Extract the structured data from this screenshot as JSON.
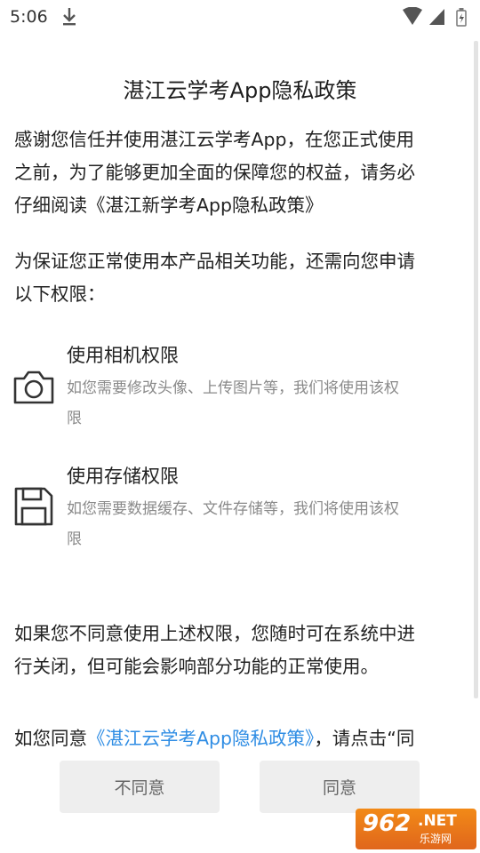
{
  "status_bar": {
    "time": "5:06",
    "icons": [
      "download-icon",
      "wifi-icon",
      "signal-icon",
      "battery-icon"
    ]
  },
  "dialog": {
    "title": "湛江云学考App隐私政策",
    "intro_line1": "感谢您信任并使用湛江云学考App，在您正式使用",
    "intro_line2": "之前，为了能够更加全面的保障您的权益，请务必",
    "intro_line3": "仔细阅读《湛江新学考App隐私政策》",
    "permission_intro_line1": "为保证您正常使用本产品相关功能，还需向您申请",
    "permission_intro_line2": "以下权限：",
    "permissions": [
      {
        "title": "使用相机权限",
        "desc_line1": "如您需要修改头像、上传图片等，我们将使用该权",
        "desc_line2": "限",
        "icon": "camera-icon"
      },
      {
        "title": "使用存储权限",
        "desc_line1": "如您需要数据缓存、文件存储等，我们将使用该权",
        "desc_line2": "限",
        "icon": "floppy-disk-icon"
      }
    ],
    "disagree_note_line1": "如果您不同意使用上述权限，您随时可在系统中进",
    "disagree_note_line2": "行关闭，但可能会影响部分功能的正常使用。",
    "consent_prefix": "如您同意",
    "consent_link": "《湛江云学考App隐私政策》",
    "consent_suffix": "，请点击“同",
    "disagree_button": "不同意",
    "agree_button": "同意"
  },
  "watermark": {
    "number": "962",
    "domain": ".NET",
    "site": "乐游网"
  },
  "colors": {
    "link": "#2f8de4",
    "button_bg": "#eeeeee",
    "watermark": "#f07a18"
  }
}
